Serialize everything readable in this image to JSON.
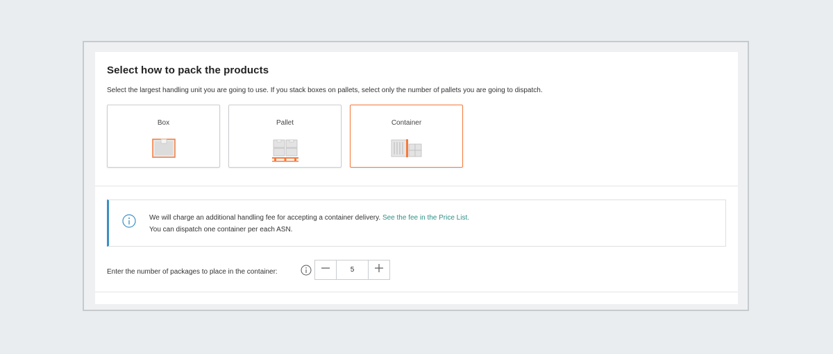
{
  "section": {
    "title": "Select how to pack the products",
    "subtitle": "Select the largest handling unit you are going to use. If you stack boxes on pallets, select only the number of pallets you are going to dispatch."
  },
  "options": [
    {
      "label": "Box",
      "icon": "box-icon",
      "selected": false
    },
    {
      "label": "Pallet",
      "icon": "pallet-icon",
      "selected": false
    },
    {
      "label": "Container",
      "icon": "container-icon",
      "selected": true
    }
  ],
  "info": {
    "icon": "info-icon",
    "line1": "We will charge an additional handling fee for accepting a container delivery.",
    "link": "See the fee in the Price List.",
    "line2": "You can dispatch one container per each ASN."
  },
  "quantity": {
    "label": "Enter the number of packages to place in the container:",
    "help_icon": "info-icon",
    "value": "5",
    "decrement_icon": "minus-icon",
    "increment_icon": "plus-icon"
  },
  "colors": {
    "accent": "#f47a3c",
    "info_bar": "#3b8fc4",
    "link": "#2d8f87",
    "background": "#e9edf0"
  }
}
